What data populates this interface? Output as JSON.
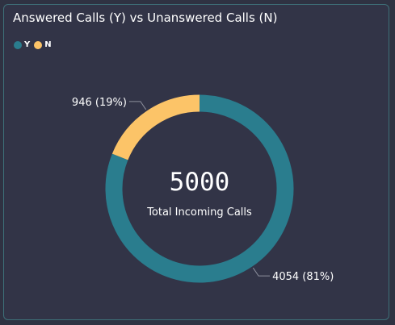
{
  "chart_data": {
    "type": "pie",
    "title": "Answered Calls (Y) vs Unanswered Calls (N)",
    "total": 5000,
    "center_label": "Total Incoming Calls",
    "legend_position": "top-left",
    "categories": [
      "Y",
      "N"
    ],
    "values": [
      4054,
      946
    ],
    "percent_labels": [
      "81%",
      "19%"
    ],
    "data_labels": [
      "4054 (81%)",
      "946 (19%)"
    ],
    "colors": [
      "#2a7d8e",
      "#fcc468"
    ]
  }
}
